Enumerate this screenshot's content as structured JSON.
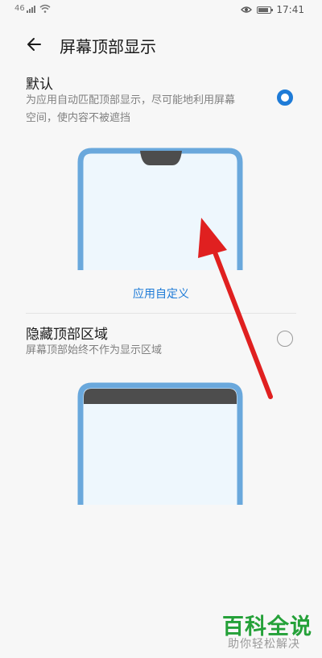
{
  "status_bar": {
    "network": "46",
    "time": "17:41"
  },
  "header": {
    "title": "屏幕顶部显示"
  },
  "options": [
    {
      "title": "默认",
      "description_line1": "为应用自动匹配顶部显示，尽可能地利用屏幕",
      "description_line2": "空间，使内容不被遮挡",
      "selected": true
    },
    {
      "title": "隐藏顶部区域",
      "description": "屏幕顶部始终不作为显示区域",
      "selected": false
    }
  ],
  "custom_link": "应用自定义",
  "colors": {
    "accent": "#1e7bd7",
    "phone_frame": "#6aa8dc",
    "phone_screen": "#eef7fd",
    "arrow": "#e02020",
    "watermark": "#25a139"
  },
  "watermark": {
    "logo": "百科全说",
    "tagline": "助你轻松解决"
  }
}
